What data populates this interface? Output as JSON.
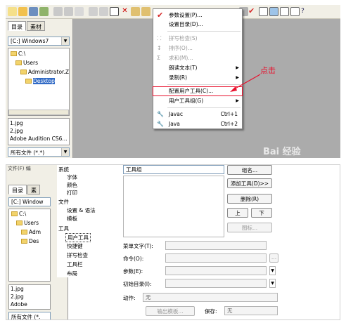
{
  "top": {
    "left_tabs": [
      "目录",
      "素材"
    ],
    "path_combo": "[C:] Windows7",
    "tree": [
      "C:\\",
      "Users",
      "Administrator.ZC",
      "Desktop"
    ],
    "files": [
      "1.jpg",
      "2.jpg",
      "Adobe Audition CS6..."
    ],
    "filter_combo": "所有文件 (*.*)",
    "menu": {
      "items": [
        {
          "label": "参数设置(P)...",
          "shortcut": "",
          "submenu": false,
          "disabled": false,
          "icon": "checkmark-icon"
        },
        {
          "label": "设置目录(D)...",
          "shortcut": "",
          "submenu": false,
          "disabled": false,
          "icon": ""
        },
        {
          "label": "拼写检查(S)",
          "shortcut": "",
          "submenu": false,
          "disabled": true,
          "icon": "spell-icon"
        },
        {
          "label": "排序(O)...",
          "shortcut": "",
          "submenu": false,
          "disabled": true,
          "icon": "sort-icon"
        },
        {
          "label": "求和(M)...",
          "shortcut": "",
          "submenu": false,
          "disabled": true,
          "icon": "sum-icon"
        },
        {
          "label": "朗读文本(T)",
          "shortcut": "",
          "submenu": true,
          "disabled": false,
          "icon": ""
        },
        {
          "label": "录制(R)",
          "shortcut": "",
          "submenu": true,
          "disabled": false,
          "icon": ""
        },
        {
          "label": "配置用户工具(C)...",
          "shortcut": "",
          "submenu": false,
          "disabled": false,
          "icon": ""
        },
        {
          "label": "用户工具组(G)",
          "shortcut": "",
          "submenu": true,
          "disabled": false,
          "icon": ""
        },
        {
          "label": "Javac",
          "shortcut": "Ctrl+1",
          "submenu": false,
          "disabled": false,
          "icon": "wrench-icon"
        },
        {
          "label": "Java",
          "shortcut": "Ctrl+2",
          "submenu": false,
          "disabled": false,
          "icon": "wrench-icon"
        }
      ]
    },
    "annotation": "点击",
    "watermark": "Bai 经验"
  },
  "bottom": {
    "menu_partial": "文件(F) 编",
    "left_tabs": [
      "目录",
      "素"
    ],
    "path_combo": "[C:] Window",
    "tree": [
      "C:\\",
      "Users",
      "Adm",
      "Des"
    ],
    "files": [
      "1.jpg",
      "2.jpg",
      "Adobe"
    ],
    "filter_combo": "所有文件 (*.",
    "categories": [
      {
        "label": "系统",
        "children": [
          "字体",
          "颜色",
          "打印"
        ]
      },
      {
        "label": "文件",
        "children": [
          "设置 & 语法",
          "模板"
        ]
      },
      {
        "label": "工具",
        "children": [
          "用户工具",
          "快捷键",
          "拼写检查",
          "工具栏",
          "布局"
        ]
      }
    ],
    "group_select": "工具组",
    "buttons": {
      "group": "组名...",
      "add_tool": "添加工具(D)>>",
      "delete": "删除(R)",
      "up": "上",
      "down": "下",
      "icon": "图标...",
      "output_template": "输出模板..."
    },
    "fields": {
      "menu_text": "菜单文字(T):",
      "command": "命令(O):",
      "params": "参数(E):",
      "init_dir": "初始目录(I):",
      "action": "动作:",
      "action_value": "无",
      "save": "保存:",
      "save_value": "无"
    },
    "ellipsis": "..."
  },
  "colors": {
    "accent_red": "#e8112d",
    "selection": "#316ac5"
  }
}
